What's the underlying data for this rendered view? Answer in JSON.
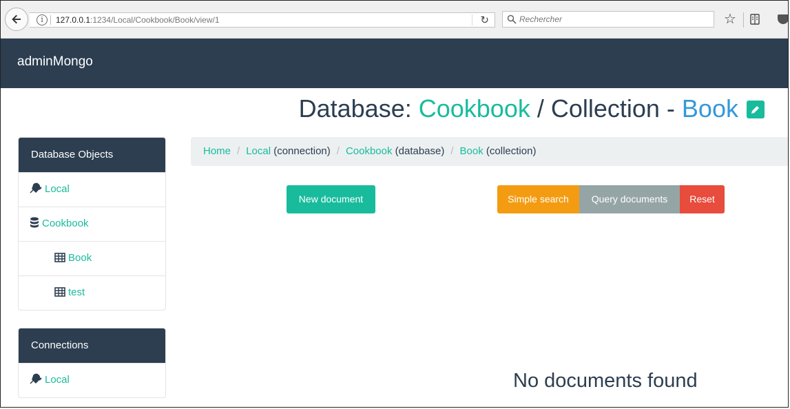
{
  "browser": {
    "url_host": "127.0.0.1",
    "url_rest": ":1234/Local/Cookbook/Book/view/1",
    "search_placeholder": "Rechercher",
    "icons": [
      "back-arrow-icon",
      "info-icon",
      "reload-icon",
      "search-icon",
      "star-icon",
      "reader-icon",
      "pocket-icon"
    ]
  },
  "navbar": {
    "brand": "adminMongo"
  },
  "title": {
    "db_prefix": "Database: ",
    "db_name": "Cookbook",
    "coll_prefix": " / Collection - ",
    "coll_name": "Book"
  },
  "sidebar": {
    "db_objects": {
      "heading": "Database Objects",
      "items": [
        {
          "label": "Local",
          "icon": "plug-icon"
        },
        {
          "label": "Cookbook",
          "icon": "database-icon"
        },
        {
          "label": "Book",
          "icon": "table-icon"
        },
        {
          "label": "test",
          "icon": "table-icon"
        }
      ]
    },
    "connections": {
      "heading": "Connections",
      "items": [
        {
          "label": "Local",
          "icon": "plug-icon"
        }
      ]
    }
  },
  "breadcrumb": {
    "home": "Home",
    "sep": "/",
    "items": [
      {
        "link": "Local",
        "suffix": " (connection)"
      },
      {
        "link": "Cookbook",
        "suffix": " (database)"
      },
      {
        "link": "Book",
        "suffix": " (collection)"
      }
    ]
  },
  "buttons": {
    "new_document": "New document",
    "simple_search": "Simple search",
    "query_documents": "Query documents",
    "reset": "Reset"
  },
  "empty_message": "No documents found",
  "colors": {
    "navy": "#2c3e50",
    "teal": "#18bc9c",
    "blue": "#3498db",
    "orange": "#f39c12",
    "gray": "#95a5a6",
    "red": "#e74c3c"
  }
}
